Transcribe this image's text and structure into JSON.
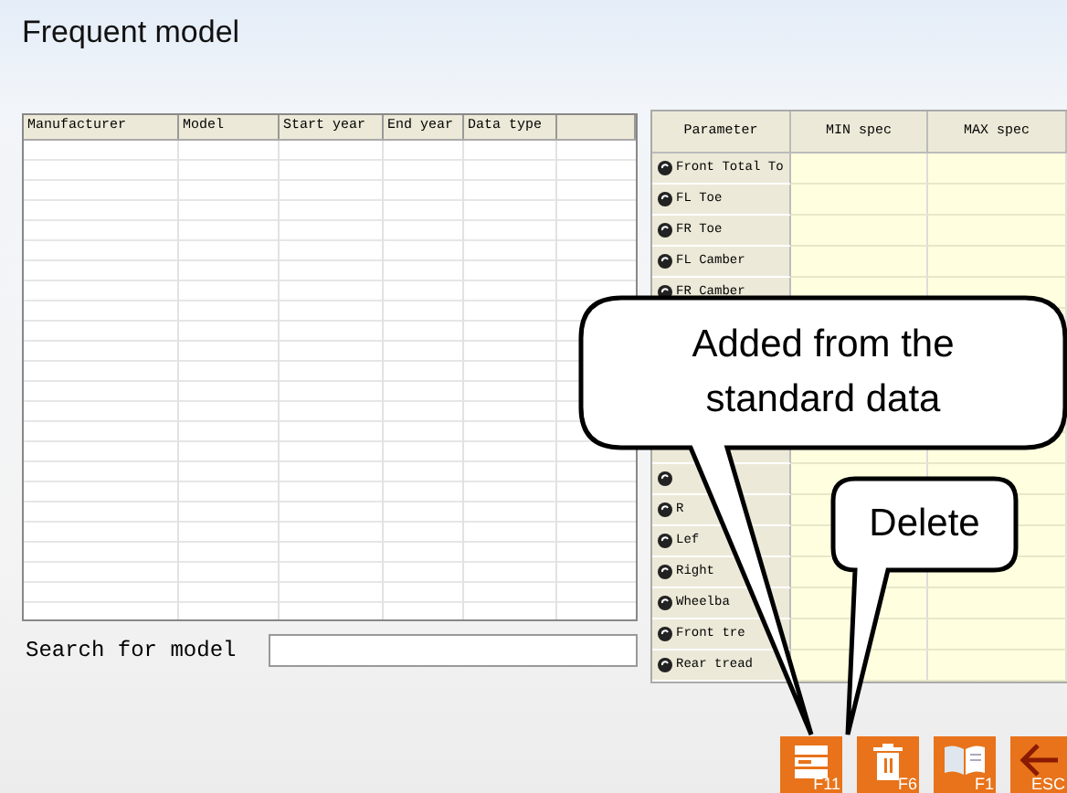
{
  "title": "Frequent model",
  "model_table": {
    "columns": [
      "Manufacturer",
      "Model",
      "Start year",
      "End year",
      "Data type"
    ]
  },
  "search": {
    "label": "Search for model"
  },
  "spec_table": {
    "columns": [
      "Parameter",
      "MIN spec",
      "MAX spec"
    ],
    "rows": [
      {
        "label": "Front Total To",
        "icon": true
      },
      {
        "label": "FL Toe",
        "icon": true
      },
      {
        "label": "FR Toe",
        "icon": true
      },
      {
        "label": "FL Camber",
        "icon": true
      },
      {
        "label": "FR Camber",
        "icon": true
      },
      {},
      {},
      {},
      {},
      {},
      {
        "icon": true
      },
      {
        "label": "R",
        "icon": true
      },
      {
        "label": "Lef",
        "icon": true
      },
      {
        "label": "Right",
        "icon": true
      },
      {
        "label": "Wheelba",
        "icon": true
      },
      {
        "label": "Front tre",
        "icon": true
      },
      {
        "label": "Rear tread",
        "icon": true
      }
    ]
  },
  "callouts": [
    {
      "text": "Added from the standard data"
    },
    {
      "text": "Delete"
    }
  ],
  "function_keys": [
    {
      "kind": "add",
      "label": "F11"
    },
    {
      "kind": "delete",
      "label": "F6"
    },
    {
      "kind": "help",
      "label": "F1"
    },
    {
      "kind": "back",
      "label": "ESC"
    }
  ]
}
